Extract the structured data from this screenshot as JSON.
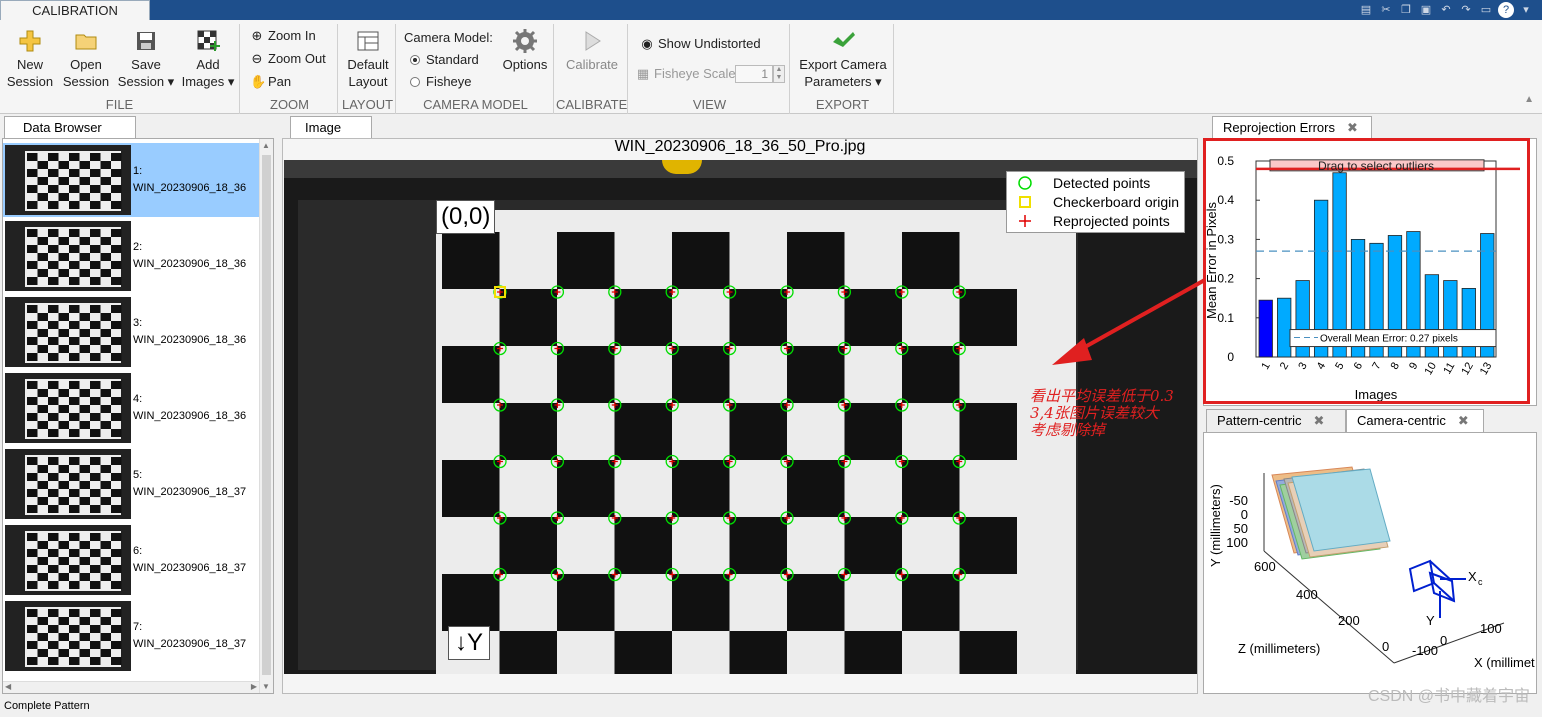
{
  "app": {
    "tab": "CALIBRATION"
  },
  "ribbon": {
    "file": {
      "label": "FILE",
      "new": [
        "New",
        "Session"
      ],
      "open": [
        "Open",
        "Session"
      ],
      "save": [
        "Save",
        "Session ▾"
      ],
      "add": [
        "Add",
        "Images ▾"
      ]
    },
    "zoom": {
      "label": "ZOOM",
      "zoom_in": "Zoom In",
      "zoom_out": "Zoom Out",
      "pan": "Pan"
    },
    "layout": {
      "label": "LAYOUT",
      "default": [
        "Default",
        "Layout"
      ]
    },
    "camera_model": {
      "label": "CAMERA MODEL",
      "title": "Camera Model:",
      "standard": "Standard",
      "fisheye": "Fisheye",
      "options": "Options"
    },
    "calibrate": {
      "label": "CALIBRATE",
      "button": "Calibrate"
    },
    "view": {
      "label": "VIEW",
      "show_undistorted": "Show Undistorted",
      "fisheye_scale": "Fisheye Scale",
      "scale_value": "1"
    },
    "export": {
      "label": "EXPORT",
      "button": [
        "Export Camera",
        "Parameters ▾"
      ]
    }
  },
  "data_browser": {
    "tab": "Data Browser",
    "items": [
      {
        "index": "1:",
        "name": "WIN_20230906_18_36"
      },
      {
        "index": "2:",
        "name": "WIN_20230906_18_36"
      },
      {
        "index": "3:",
        "name": "WIN_20230906_18_36"
      },
      {
        "index": "4:",
        "name": "WIN_20230906_18_36"
      },
      {
        "index": "5:",
        "name": "WIN_20230906_18_37"
      },
      {
        "index": "6:",
        "name": "WIN_20230906_18_37"
      },
      {
        "index": "7:",
        "name": "WIN_20230906_18_37"
      }
    ]
  },
  "image_panel": {
    "tab": "Image",
    "title": "WIN_20230906_18_36_50_Pro.jpg",
    "origin_label": "(0,0)",
    "y_label": "↓Y",
    "legend": [
      "Detected points",
      "Checkerboard origin",
      "Reprojected points"
    ]
  },
  "reprojection": {
    "tab": "Reprojection Errors",
    "drag_hint": "Drag to select outliers",
    "mean_label": "Overall Mean Error: 0.27 pixels",
    "colors": {
      "bar": "#00aaff",
      "selected": "#0000ff",
      "threshold": "#e02020",
      "mean": "#4a90c0"
    }
  },
  "chart_data": {
    "type": "bar",
    "title": "",
    "xlabel": "Images",
    "ylabel": "Mean Error in Pixels",
    "categories": [
      "1",
      "2",
      "3",
      "4",
      "5",
      "6",
      "7",
      "8",
      "9",
      "10",
      "11",
      "12",
      "13"
    ],
    "values": [
      0.145,
      0.15,
      0.195,
      0.4,
      0.47,
      0.3,
      0.29,
      0.31,
      0.32,
      0.21,
      0.195,
      0.175,
      0.315
    ],
    "ylim": [
      0,
      0.5
    ],
    "yticks": [
      "0",
      "0.1",
      "0.2",
      "0.3",
      "0.4",
      "0.5"
    ],
    "mean": 0.27,
    "threshold": 0.48,
    "selected_index": 0
  },
  "camera_view": {
    "tab_pattern": "Pattern-centric",
    "tab_camera": "Camera-centric",
    "y_axis": "Y (millimeters)",
    "z_axis": "Z (millimeters)",
    "x_axis": "X (millimet",
    "y_ticks": [
      "-50",
      "0",
      "50",
      "100"
    ],
    "z_ticks": [
      "600",
      "400",
      "200",
      "0"
    ],
    "x_ticks": [
      "100",
      "0",
      "-100"
    ],
    "cam_x": "X",
    "cam_x_sub": "c",
    "cam_y": "Y"
  },
  "annotation": {
    "line1": "看出平均误差低于0.3",
    "line2": "3,4张图片误差较大",
    "line3": "考虑剔除掉"
  },
  "status": {
    "text": "Complete Pattern"
  },
  "watermark": "CSDN @书中藏着宇宙"
}
